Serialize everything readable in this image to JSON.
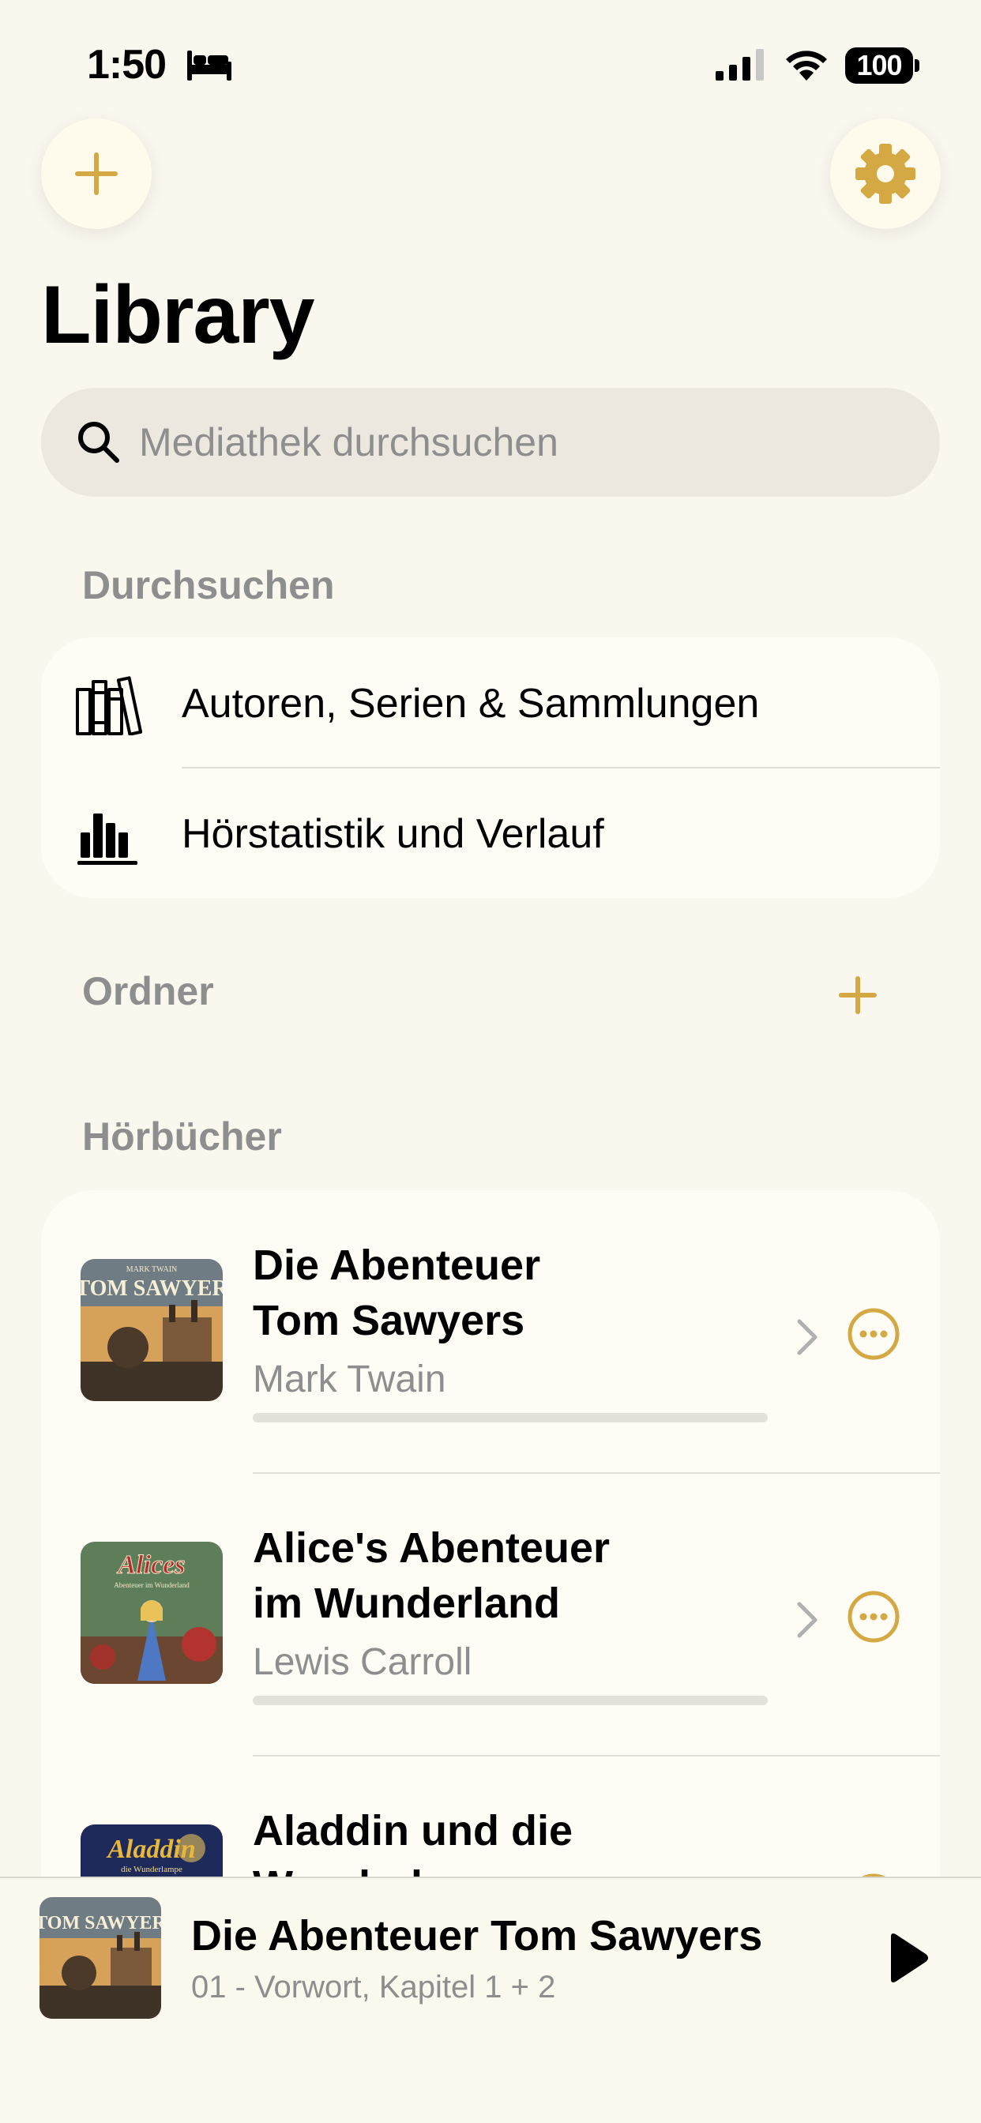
{
  "status_bar": {
    "time": "1:50",
    "battery": "100"
  },
  "page": {
    "title": "Library"
  },
  "search": {
    "placeholder": "Mediathek durchsuchen"
  },
  "sections": {
    "browse": "Durchsuchen",
    "folders": "Ordner",
    "audiobooks": "Hörbücher"
  },
  "browse_items": [
    {
      "label": "Autoren, Serien & Sammlungen",
      "icon": "books-shelf-icon"
    },
    {
      "label": "Hörstatistik und Verlauf",
      "icon": "bar-chart-icon"
    }
  ],
  "audiobooks": [
    {
      "title_line1": "Die Abenteuer",
      "title_line2": "Tom Sawyers",
      "author": "Mark Twain",
      "cover_top": "MARK TWAIN",
      "cover_title": "TOM SAWYER",
      "progress": 0.0
    },
    {
      "title_line1": "Alice's Abenteuer",
      "title_line2": "im Wunderland",
      "author": "Lewis Carroll",
      "cover_title": "Alices",
      "cover_sub": "Abenteuer im Wunderland",
      "progress": 0.0
    },
    {
      "title_line1": "Aladdin und die",
      "title_line2": "Wunderlampe",
      "cover_title": "Aladdin",
      "cover_sub": "die Wunderlampe"
    }
  ],
  "now_playing": {
    "title": "Die Abenteuer Tom Sawyers",
    "chapter": "01 - Vorwort, Kapitel 1 + 2",
    "cover_title": "TOM SAWYER"
  },
  "colors": {
    "accent": "#D4A843",
    "background": "#FAF7EE",
    "card": "#FEFCF5",
    "secondary_text": "#8E8E8E"
  }
}
